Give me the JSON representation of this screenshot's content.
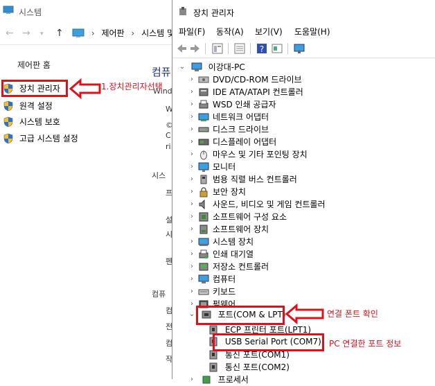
{
  "system_window": {
    "title": "시스템",
    "breadcrumb": [
      "제어판",
      "시스템 및"
    ],
    "sidebar_home": "제어판 홈",
    "links": [
      {
        "label": "장치 관리자"
      },
      {
        "label": "원격 설정"
      },
      {
        "label": "시스템 보호"
      },
      {
        "label": "고급 시스템 설정"
      }
    ],
    "main_title": "컴퓨",
    "fragments": [
      {
        "text": "Wind"
      },
      {
        "text": "W"
      },
      {
        "text": "©"
      },
      {
        "text": "C"
      },
      {
        "text": "ri"
      },
      {
        "text": "시스"
      },
      {
        "text": "프"
      },
      {
        "text": "설"
      },
      {
        "text": "시"
      },
      {
        "text": "펜"
      },
      {
        "text": "컴퓨"
      },
      {
        "text": "컴"
      },
      {
        "text": "전"
      },
      {
        "text": "컴"
      },
      {
        "text": "작"
      }
    ]
  },
  "device_manager": {
    "title": "장치 관리자",
    "menu": [
      "파일(F)",
      "동작(A)",
      "보기(V)",
      "도움말(H)"
    ],
    "root": "이강대-PC",
    "categories": [
      {
        "label": "DVD/CD-ROM 드라이브",
        "icon": "dvd-drive-icon"
      },
      {
        "label": "IDE ATA/ATAPI 컨트롤러",
        "icon": "ide-controller-icon"
      },
      {
        "label": "WSD 인쇄 공급자",
        "icon": "wsd-print-provider-icon"
      },
      {
        "label": "네트워크 어댑터",
        "icon": "network-adapter-icon"
      },
      {
        "label": "디스크 드라이브",
        "icon": "disk-drive-icon"
      },
      {
        "label": "디스플레이 어댑터",
        "icon": "display-adapter-icon"
      },
      {
        "label": "마우스 및 기타 포인팅 장치",
        "icon": "mouse-icon"
      },
      {
        "label": "모니터",
        "icon": "monitor-icon"
      },
      {
        "label": "범용 직렬 버스 컨트롤러",
        "icon": "usb-controller-icon"
      },
      {
        "label": "보안 장치",
        "icon": "security-device-icon"
      },
      {
        "label": "사운드, 비디오 및 게임 컨트롤러",
        "icon": "sound-icon"
      },
      {
        "label": "소프트웨어 구성 요소",
        "icon": "software-component-icon"
      },
      {
        "label": "소프트웨어 장치",
        "icon": "software-device-icon"
      },
      {
        "label": "시스템 장치",
        "icon": "system-device-icon"
      },
      {
        "label": "인쇄 대기열",
        "icon": "print-queue-icon"
      },
      {
        "label": "저장소 컨트롤러",
        "icon": "storage-controller-icon"
      },
      {
        "label": "컴퓨터",
        "icon": "computer-icon"
      },
      {
        "label": "키보드",
        "icon": "keyboard-icon"
      },
      {
        "label": "펌웨어",
        "icon": "firmware-icon"
      }
    ],
    "ports_category": "포트(COM & LPT)",
    "ports_children": [
      "ECP 프린터 포트(LPT1)",
      "USB Serial Port (COM7)",
      "통신 포트(COM1)",
      "통신 포트(COM2)"
    ],
    "cut_off_row": "프로세서"
  },
  "annotations": {
    "step1": "1.장치관리자선택",
    "port_check": "연결 폰트 확인",
    "pc_port_info": "PC 연결한 포트 정보",
    "color": "#e0101a"
  }
}
